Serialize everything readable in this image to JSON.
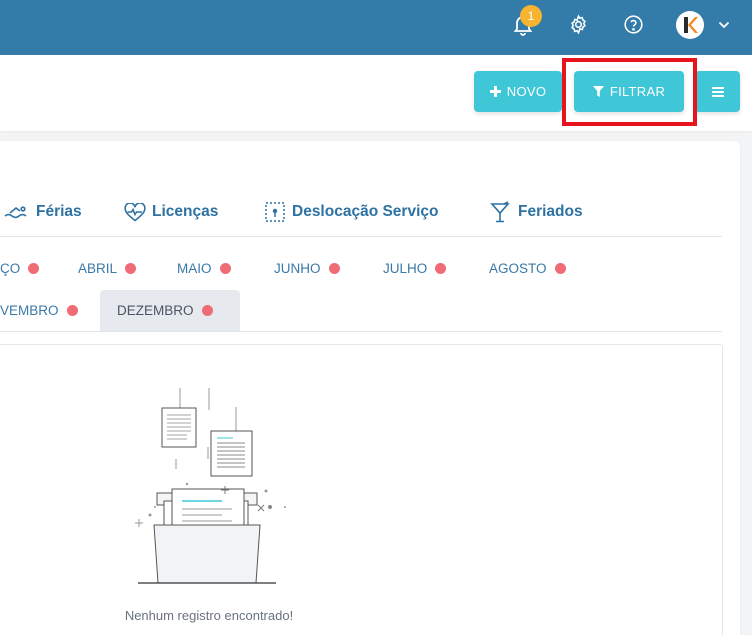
{
  "topbar": {
    "notification_count": "1",
    "icons": [
      "bell-icon",
      "gear-icon",
      "help-icon",
      "avatar",
      "chevron-down-icon"
    ],
    "color": "#337ba8"
  },
  "toolbar": {
    "novo_label": "NOVO",
    "filtrar_label": "FILTRAR",
    "accent": "#3fc7d8",
    "highlight_color": "#e8141d"
  },
  "tabs": [
    {
      "label": "Férias",
      "icon": "swimmer-icon"
    },
    {
      "label": "Licenças",
      "icon": "heartbeat-icon"
    },
    {
      "label": "Deslocação Serviço",
      "icon": "route-icon"
    },
    {
      "label": "Feriados",
      "icon": "cocktail-icon"
    }
  ],
  "months": {
    "row1": [
      "ÇO",
      "ABRIL",
      "MAIO",
      "JUNHO",
      "JULHO",
      "AGOSTO"
    ],
    "row2": [
      "VEMBRO",
      "DEZEMBRO"
    ],
    "active": "DEZEMBRO",
    "dot_color": "#ef6b76"
  },
  "empty": {
    "message": "Nenhum registro encontrado!"
  }
}
